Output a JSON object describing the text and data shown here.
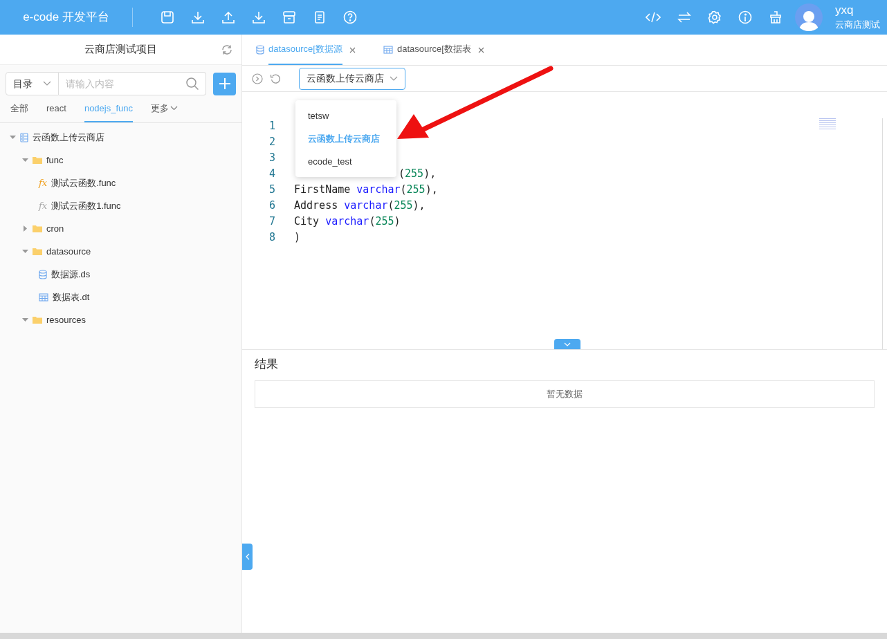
{
  "header": {
    "logo": "e-code 开发平台",
    "user": {
      "name": "yxq",
      "subtitle": "云商店测试"
    }
  },
  "sidebar": {
    "title": "云商店测试项目",
    "scope": "目录",
    "search": {
      "placeholder": "请输入内容"
    },
    "tabs": [
      {
        "label": "全部",
        "selected": false
      },
      {
        "label": "react",
        "selected": false
      },
      {
        "label": "nodejs_func",
        "selected": true
      },
      {
        "label": "更多",
        "selected": false
      }
    ],
    "tree": [
      {
        "label": "云函数上传云商店",
        "kind": "project",
        "expanded": true,
        "children": [
          {
            "label": "func",
            "kind": "folder",
            "expanded": true,
            "children": [
              {
                "label": "测试云函数.func",
                "kind": "func-active",
                "icon": "fx"
              },
              {
                "label": "测试云函数1.func",
                "kind": "func",
                "icon": "fx"
              }
            ]
          },
          {
            "label": "cron",
            "kind": "folder",
            "expanded": false
          },
          {
            "label": "datasource",
            "kind": "folder",
            "expanded": true,
            "children": [
              {
                "label": "数据源.ds",
                "kind": "ds"
              },
              {
                "label": "数据表.dt",
                "kind": "dt"
              }
            ]
          },
          {
            "label": "resources",
            "kind": "folder",
            "expanded": true
          }
        ]
      }
    ]
  },
  "editor": {
    "tabs": [
      {
        "label": "datasource[数据源",
        "kind": "ds",
        "selected": true
      },
      {
        "label": "datasource[数据表",
        "kind": "dt",
        "selected": false
      }
    ],
    "selector": {
      "value": "云函数上传云商店",
      "options": [
        {
          "label": "tetsw",
          "selected": false
        },
        {
          "label": "云函数上传云商店",
          "selected": true
        },
        {
          "label": "ecode_test",
          "selected": false
        }
      ]
    },
    "lines": [
      {
        "number": "1"
      },
      {
        "number": "2"
      },
      {
        "number": "3"
      },
      {
        "number": "4",
        "covered": true,
        "tokens": [
          {
            "text": "(",
            "kind": "plain"
          },
          {
            "text": "255",
            "kind": "number"
          },
          {
            "text": "),",
            "kind": "plain"
          }
        ]
      },
      {
        "number": "5",
        "tokens": [
          {
            "text": "FirstName ",
            "kind": "plain"
          },
          {
            "text": "varchar",
            "kind": "keyword"
          },
          {
            "text": "(",
            "kind": "plain"
          },
          {
            "text": "255",
            "kind": "number"
          },
          {
            "text": "),",
            "kind": "plain"
          }
        ]
      },
      {
        "number": "6",
        "tokens": [
          {
            "text": "Address ",
            "kind": "plain"
          },
          {
            "text": "varchar",
            "kind": "keyword"
          },
          {
            "text": "(",
            "kind": "plain"
          },
          {
            "text": "255",
            "kind": "number"
          },
          {
            "text": "),",
            "kind": "plain"
          }
        ]
      },
      {
        "number": "7",
        "tokens": [
          {
            "text": "City ",
            "kind": "plain"
          },
          {
            "text": "varchar",
            "kind": "keyword"
          },
          {
            "text": "(",
            "kind": "plain"
          },
          {
            "text": "255",
            "kind": "number"
          },
          {
            "text": ")",
            "kind": "plain"
          }
        ]
      },
      {
        "number": "8",
        "tokens": [
          {
            "text": ")",
            "kind": "plain"
          }
        ]
      }
    ]
  },
  "results": {
    "title": "结果",
    "empty": "暂无数据"
  }
}
